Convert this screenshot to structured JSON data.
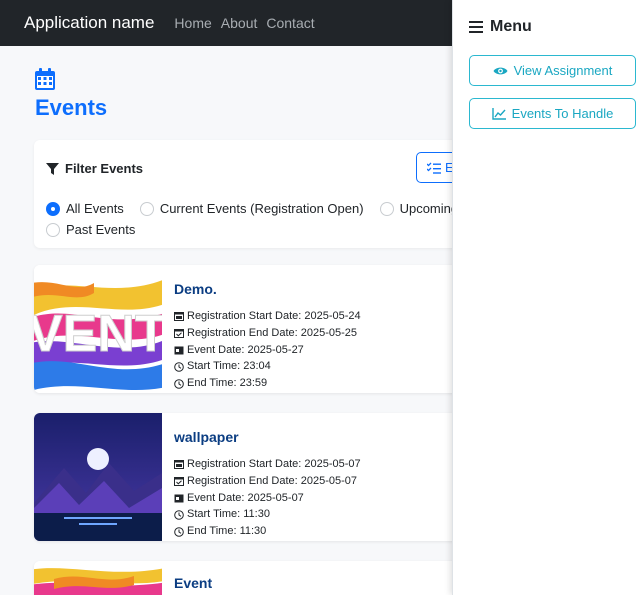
{
  "navbar": {
    "brand": "Application name",
    "links": [
      "Home",
      "About",
      "Contact"
    ]
  },
  "page": {
    "title": "Events",
    "icon": "calendar-icon"
  },
  "filter": {
    "title": "Filter Events",
    "expand_label": "E",
    "options": [
      "All Events",
      "Current Events (Registration Open)",
      "Upcoming E",
      "Past Events"
    ],
    "selected": "All Events"
  },
  "events": [
    {
      "title": "Demo.",
      "registration_start": "Registration Start Date: 2025-05-24",
      "registration_end": "Registration End Date: 2025-05-25",
      "event_date": "Event Date: 2025-05-27",
      "start_time": "Start Time: 23:04",
      "end_time": "End Time: 23:59",
      "image_text": "VENT"
    },
    {
      "title": "wallpaper",
      "registration_start": "Registration Start Date: 2025-05-07",
      "registration_end": "Registration End Date: 2025-05-07",
      "event_date": "Event Date: 2025-05-07",
      "start_time": "Start Time: 11:30",
      "end_time": "End Time: 11:30"
    },
    {
      "title": "Event"
    }
  ],
  "menu": {
    "title": "Menu",
    "buttons": [
      "View Assignment",
      "Events To Handle"
    ]
  },
  "colors": {
    "primary": "#0d6efd",
    "navbar": "#212529",
    "event_title": "#0b3d82",
    "menu_button": "#1aa7c2"
  }
}
